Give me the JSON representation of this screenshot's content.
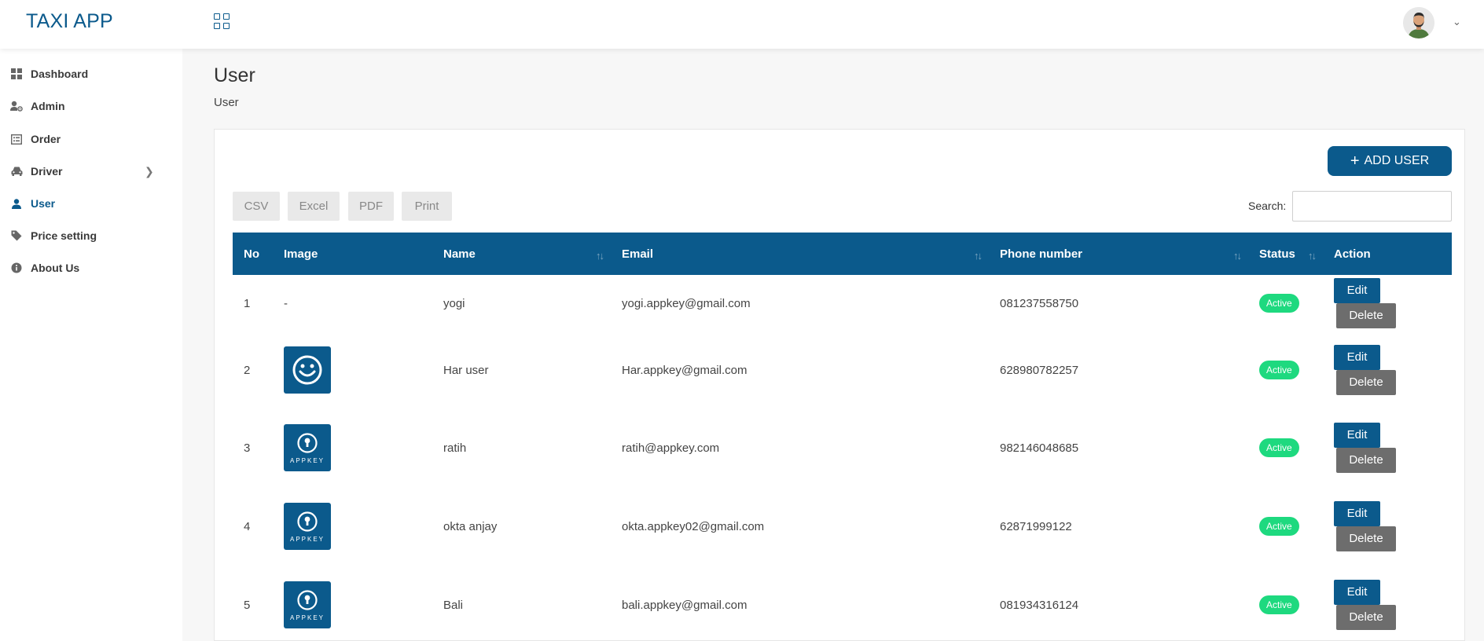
{
  "app": {
    "title": "TAXI APP"
  },
  "sidebar": {
    "items": [
      {
        "label": "Dashboard",
        "icon": "dashboard-icon"
      },
      {
        "label": "Admin",
        "icon": "user-gear-icon"
      },
      {
        "label": "Order",
        "icon": "list-icon"
      },
      {
        "label": "Driver",
        "icon": "car-icon"
      },
      {
        "label": "User",
        "icon": "user-icon"
      },
      {
        "label": "Price setting",
        "icon": "tag-icon"
      },
      {
        "label": "About Us",
        "icon": "info-icon"
      }
    ]
  },
  "page": {
    "title": "User",
    "breadcrumb": "User"
  },
  "toolbar": {
    "add_label": "ADD USER",
    "export": [
      "CSV",
      "Excel",
      "PDF",
      "Print"
    ],
    "search_label": "Search:",
    "search_value": ""
  },
  "table": {
    "headers": [
      "No",
      "Image",
      "Name",
      "Email",
      "Phone number",
      "Status",
      "Action"
    ],
    "rows": [
      {
        "no": "1",
        "image": "-",
        "name": "yogi",
        "email": "yogi.appkey@gmail.com",
        "phone": "081237558750",
        "status": "Active"
      },
      {
        "no": "2",
        "image": "smiley",
        "name": "Har user",
        "email": "Har.appkey@gmail.com",
        "phone": "628980782257",
        "status": "Active"
      },
      {
        "no": "3",
        "image": "APPKEY",
        "name": "ratih",
        "email": "ratih@appkey.com",
        "phone": "982146048685",
        "status": "Active"
      },
      {
        "no": "4",
        "image": "APPKEY",
        "name": "okta anjay",
        "email": "okta.appkey02@gmail.com",
        "phone": "62871999122",
        "status": "Active"
      },
      {
        "no": "5",
        "image": "APPKEY",
        "name": "Bali",
        "email": "bali.appkey@gmail.com",
        "phone": "081934316124",
        "status": "Active"
      }
    ],
    "edit_label": "Edit",
    "delete_label": "Delete"
  },
  "colors": {
    "brand": "#0b5a8c",
    "active": "#1ed97f",
    "delete": "#6d6d6d"
  }
}
